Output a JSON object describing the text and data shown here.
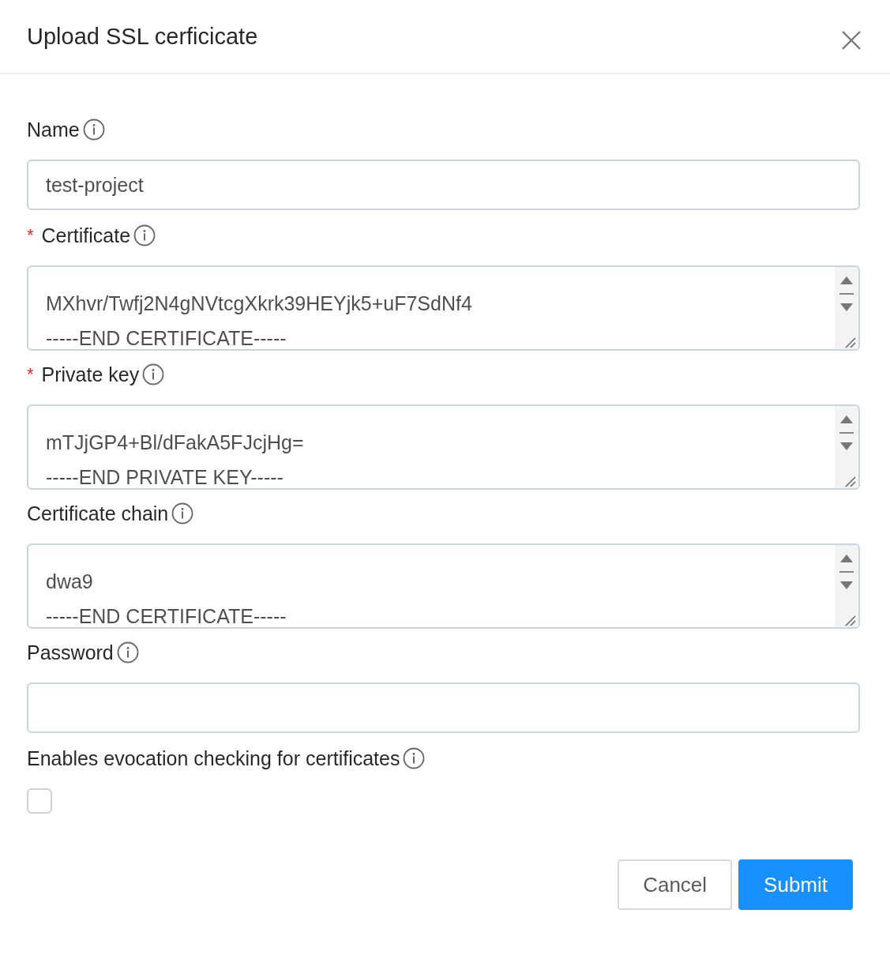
{
  "dialog": {
    "title": "Upload SSL cerficicate"
  },
  "fields": [
    {
      "kind": "input",
      "label": "Name",
      "value": "test-project"
    },
    {
      "kind": "textarea",
      "label": "Certificate",
      "required_mark": "*",
      "lines": [
        "MXhvr/Twfj2N4gNVtcgXkrk39HEYjk5+uF7SdNf4",
        "-----END CERTIFICATE-----"
      ]
    },
    {
      "kind": "textarea",
      "label": "Private key",
      "required_mark": "*",
      "lines": [
        "mTJjGP4+Bl/dFakA5FJcjHg=",
        "-----END PRIVATE KEY-----"
      ]
    },
    {
      "kind": "textarea",
      "label": "Certificate chain",
      "lines": [
        "dwa9",
        "-----END CERTIFICATE-----"
      ]
    },
    {
      "kind": "input",
      "label": "Password"
    },
    {
      "kind": "checkbox",
      "label": "Enables evocation checking for certificates",
      "checked": false
    }
  ],
  "buttons": [
    {
      "label": "Cancel",
      "kind": "default"
    },
    {
      "label": "Submit",
      "kind": "primary"
    }
  ]
}
